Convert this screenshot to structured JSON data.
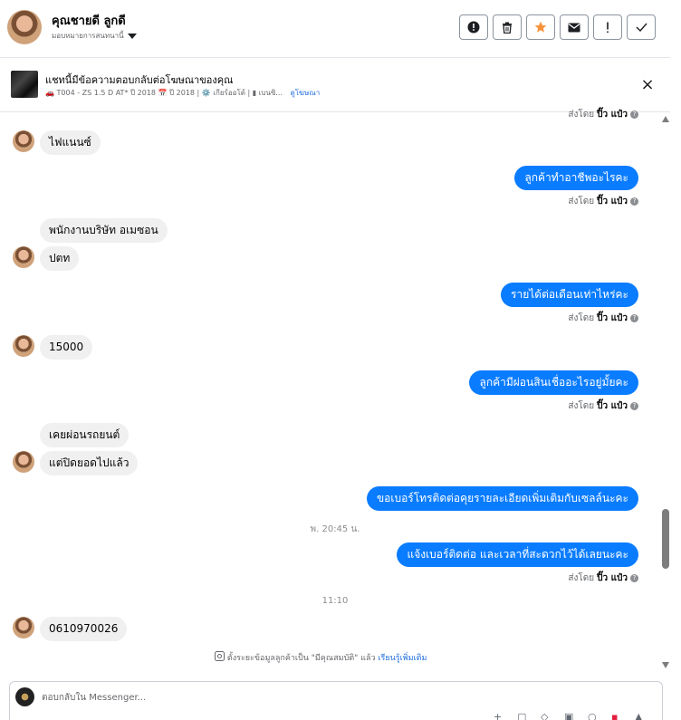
{
  "header": {
    "name": "คุณชายดี ลูกดี",
    "assign_label": "มอบหมายการสนทนานี้",
    "toolbar": [
      {
        "name": "report-button",
        "glyph": "!"
      },
      {
        "name": "delete-button",
        "glyph": "🗑"
      },
      {
        "name": "star-button",
        "glyph": "★"
      },
      {
        "name": "mark-unread-button",
        "glyph": "✉"
      },
      {
        "name": "spam-button",
        "glyph": "!"
      },
      {
        "name": "done-button",
        "glyph": "✓"
      }
    ]
  },
  "ad": {
    "title": "แชทนี้มีข้อความตอบกลับต่อโฆษณาของคุณ",
    "meta": "🚗 T004 - ZS 1.5 D AT* ปี 2018 📅 ปี 2018 | ⚙️ เกียร์ออโต้ | ▮ เบนซิ...",
    "view_link": "ดูโฆษณา",
    "close": "×"
  },
  "messages": [
    {
      "dir": "out",
      "text": "",
      "sender_prefix": "ส่งโดย",
      "sender": "ปิ๊ว แป๋ว"
    },
    {
      "dir": "in",
      "text": "ไฟแนนซ์"
    },
    {
      "dir": "out",
      "text": "ลูกค้าทำอาชีพอะไรคะ",
      "sender_prefix": "ส่งโดย",
      "sender": "ปิ๊ว แป๋ว"
    },
    {
      "dir": "in",
      "text": "พนักงานบริษัท อเมซอน"
    },
    {
      "dir": "in",
      "text": "ปตท"
    },
    {
      "dir": "out",
      "text": "รายได้ต่อเดือนเท่าไหร่คะ",
      "sender_prefix": "ส่งโดย",
      "sender": "ปิ๊ว แป๋ว"
    },
    {
      "dir": "in",
      "text": "15000"
    },
    {
      "dir": "out",
      "text": "ลูกค้ามีผ่อนสินเชื่ออะไรอยู่มั้ยคะ",
      "sender_prefix": "ส่งโดย",
      "sender": "ปิ๊ว แป๋ว"
    },
    {
      "dir": "in",
      "text": "เคยผ่อนรถยนต์"
    },
    {
      "dir": "in",
      "text": "แต่ปิดยอดไปแล้ว"
    },
    {
      "dir": "out",
      "text": "ขอเบอร์โทรติดต่อคุยรายละเอียดเพิ่มเติมกับเซลล์นะคะ"
    },
    {
      "dir": "time",
      "text": "พ. 20:45 น."
    },
    {
      "dir": "out",
      "text": "แจ้งเบอร์ติดต่อ  และเวลาที่สะดวกไว้ได้เลยนะคะ",
      "sender_prefix": "ส่งโดย",
      "sender": "ปิ๊ว แป๋ว"
    },
    {
      "dir": "time",
      "text": "11:10"
    },
    {
      "dir": "in",
      "text": "0610970026"
    }
  ],
  "notice": {
    "text": "ตั้งระยะข้อมูลลูกค้าเป็น \"มีคุณสมบัติ\" แล้ว",
    "link": "เรียนรู้เพิ่มเติม"
  },
  "composer": {
    "placeholder": "ตอบกลับใน Messenger..."
  },
  "colors": {
    "outgoing_bubble": "#0a7cff",
    "incoming_bubble": "#f0f0f0",
    "star": "#f7923b",
    "link": "#216fdb"
  }
}
